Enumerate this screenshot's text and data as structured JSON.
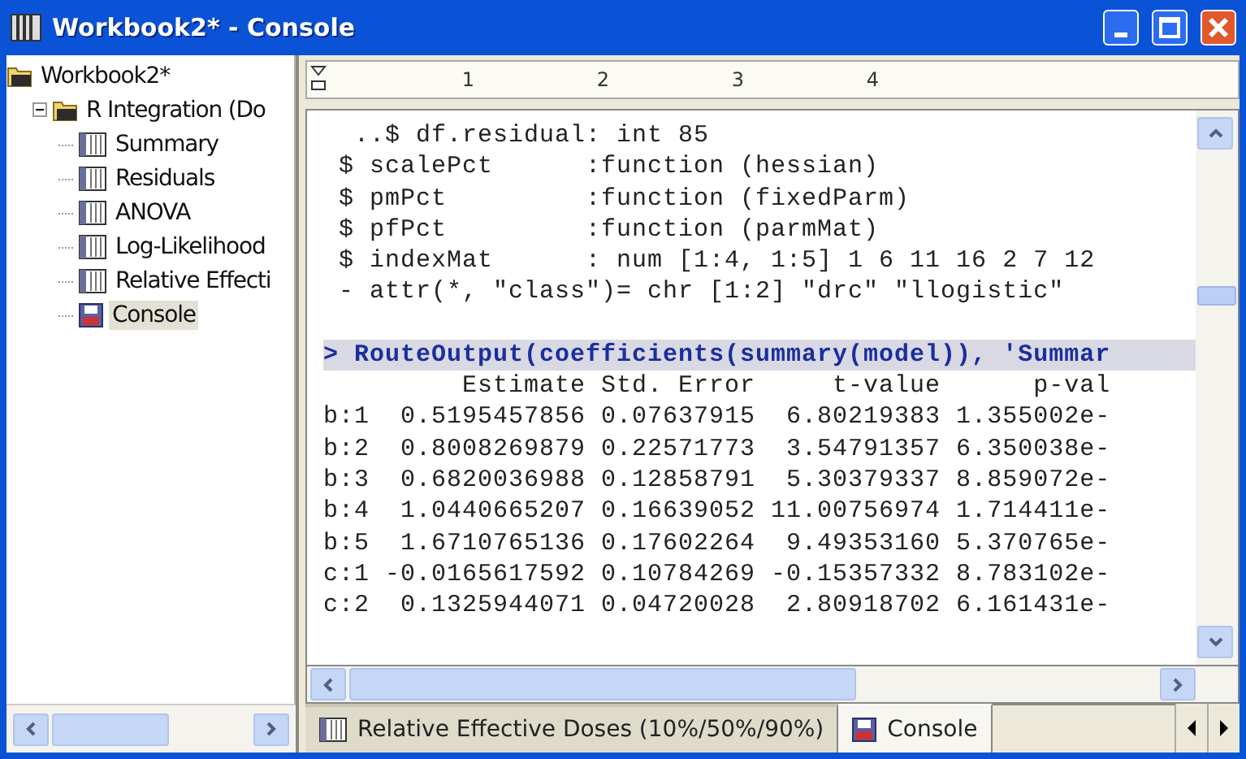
{
  "window": {
    "title": "Workbook2* - Console"
  },
  "tree": [
    {
      "label": "Workbook2*",
      "kind": "workbook",
      "selected": false,
      "children": [
        {
          "label": "R Integration (Do",
          "kind": "folder",
          "selected": false,
          "expanded": true,
          "children": [
            {
              "label": "Summary",
              "kind": "sheet",
              "selected": false
            },
            {
              "label": "Residuals",
              "kind": "sheet",
              "selected": false
            },
            {
              "label": "ANOVA",
              "kind": "sheet",
              "selected": false
            },
            {
              "label": "Log-Likelihood",
              "kind": "sheet",
              "selected": false
            },
            {
              "label": "Relative Effecti",
              "kind": "sheet",
              "selected": false
            },
            {
              "label": "Console",
              "kind": "console",
              "selected": true
            }
          ]
        }
      ]
    }
  ],
  "ruler": {
    "marks": [
      "1",
      "2",
      "3",
      "4"
    ]
  },
  "console": {
    "lines": [
      {
        "kind": "output",
        "text": "  ..$ df.residual: int 85"
      },
      {
        "kind": "output",
        "text": " $ scalePct      :function (hessian)"
      },
      {
        "kind": "output",
        "text": " $ pmPct         :function (fixedParm)"
      },
      {
        "kind": "output",
        "text": " $ pfPct         :function (parmMat)"
      },
      {
        "kind": "output",
        "text": " $ indexMat      : num [1:4, 1:5] 1 6 11 16 2 7 12"
      },
      {
        "kind": "output",
        "text": " - attr(*, \"class\")= chr [1:2] \"drc\" \"llogistic\""
      },
      {
        "kind": "command",
        "text": "> RouteOutput(coefficients(summary(model)), 'Summar"
      },
      {
        "kind": "output",
        "text": "         Estimate Std. Error     t-value      p-val"
      },
      {
        "kind": "output",
        "text": "b:1  0.5195457856 0.07637915  6.80219383 1.355002e-"
      },
      {
        "kind": "output",
        "text": "b:2  0.8008269879 0.22571773  3.54791357 6.350038e-"
      },
      {
        "kind": "output",
        "text": "b:3  0.6820036988 0.12858791  5.30379337 8.859072e-"
      },
      {
        "kind": "output",
        "text": "b:4  1.0440665207 0.16639052 11.00756974 1.714411e-"
      },
      {
        "kind": "output",
        "text": "b:5  1.6710765136 0.17602264  9.49353160 5.370765e-"
      },
      {
        "kind": "output",
        "text": "c:1 -0.0165617592 0.10784269 -0.15357332 8.783102e-"
      },
      {
        "kind": "output",
        "text": "c:2  0.1325944071 0.04720028  2.80918702 6.161431e-"
      }
    ]
  },
  "tabs": [
    {
      "label": "Relative Effective Doses (10%/50%/90%)",
      "kind": "sheet",
      "selected": false
    },
    {
      "label": "Console",
      "kind": "console",
      "selected": true
    }
  ]
}
